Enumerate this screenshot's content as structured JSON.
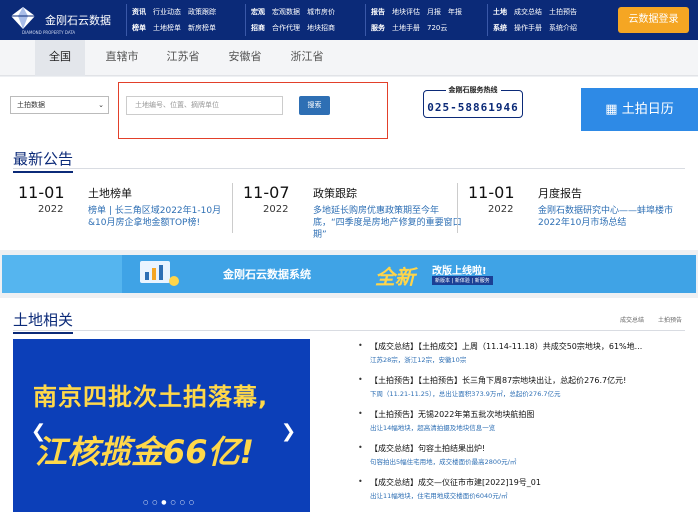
{
  "header": {
    "logo_name": "金刚石云数据",
    "logo_sub": "DIAMOND PROPERTY DATA",
    "groups": [
      {
        "row1": [
          "资讯",
          "行业动态",
          "政策跟踪"
        ],
        "row2": [
          "榜单",
          "土地榜单",
          "新房榜单"
        ]
      },
      {
        "row1": [
          "宏观",
          "宏观数据",
          "城市房价"
        ],
        "row2": [
          "招商",
          "合作代理",
          "地块招商"
        ]
      },
      {
        "row1": [
          "报告",
          "地块评估",
          "月报",
          "年报"
        ],
        "row2": [
          "服务",
          "土地手册",
          "720云"
        ]
      },
      {
        "row1": [
          "土地",
          "成交总结",
          "土拍预告"
        ],
        "row2": [
          "系统",
          "操作手册",
          "系统介绍"
        ]
      }
    ],
    "login_label": "云数据登录"
  },
  "regions": [
    "全国",
    "直辖市",
    "江苏省",
    "安徽省",
    "浙江省"
  ],
  "search": {
    "select_value": "土拍数据",
    "input_placeholder": "土地编号、位置、摘牌单位",
    "button_label": "搜索",
    "hotline_title": "金刚石服务热线",
    "hotline_number": "025-58861946",
    "calendar_label": "土拍日历"
  },
  "news": {
    "heading": "最新公告",
    "items": [
      {
        "date": "11-01",
        "year": "2022",
        "title": "土地榜单",
        "desc": "榜单 | 长三角区域2022年1-10月&10月房企拿地金额TOP榜!"
      },
      {
        "date": "11-07",
        "year": "2022",
        "title": "政策跟踪",
        "desc": "多地延长购房优惠政策期至今年底，“四季度是房地产修复的重要窗口期”"
      },
      {
        "date": "11-01",
        "year": "2022",
        "title": "月度报告",
        "desc": "金刚石数据研究中心——蚌埠楼市2022年10月市场总结"
      }
    ]
  },
  "banner": {
    "title": "金刚石云数据系统",
    "big": "全新",
    "upgrade": "改版上线啦!",
    "upgrade_sub": "新版本 | 新体验 | 新服务"
  },
  "land": {
    "heading": "土地相关",
    "tabs": [
      "成交总结",
      "土拍预告"
    ],
    "image_line1": "南京四批次土拍落幕,",
    "image_line2": "江核揽金66亿!",
    "items": [
      {
        "title": "【成交总结】【土拍成交】上周（11.14-11.18）共成交50宗地块，61%地...",
        "sub": "江苏28宗，浙江12宗，安徽10宗"
      },
      {
        "title": "【土拍预告】【土拍预告】长三角下周87宗地块出让，总起价276.7亿元!",
        "sub": "下周（11.21-11.25），总出让面积373.9万㎡，总起价276.7亿元"
      },
      {
        "title": "【土拍预告】无锡2022年第五批次地块航拍图",
        "sub": "出让14幅地块，超高清拍摄及地块信息一览"
      },
      {
        "title": "【成交总结】句容土拍结果出炉!",
        "sub": "句容拍出5幅住宅用地，成交楼面价最高2800元/㎡"
      },
      {
        "title": "【成交总结】成交—仪征市市建[2022]19号_01",
        "sub": "出让11幅地块，住宅用地成交楼面价6040元/㎡"
      }
    ]
  }
}
